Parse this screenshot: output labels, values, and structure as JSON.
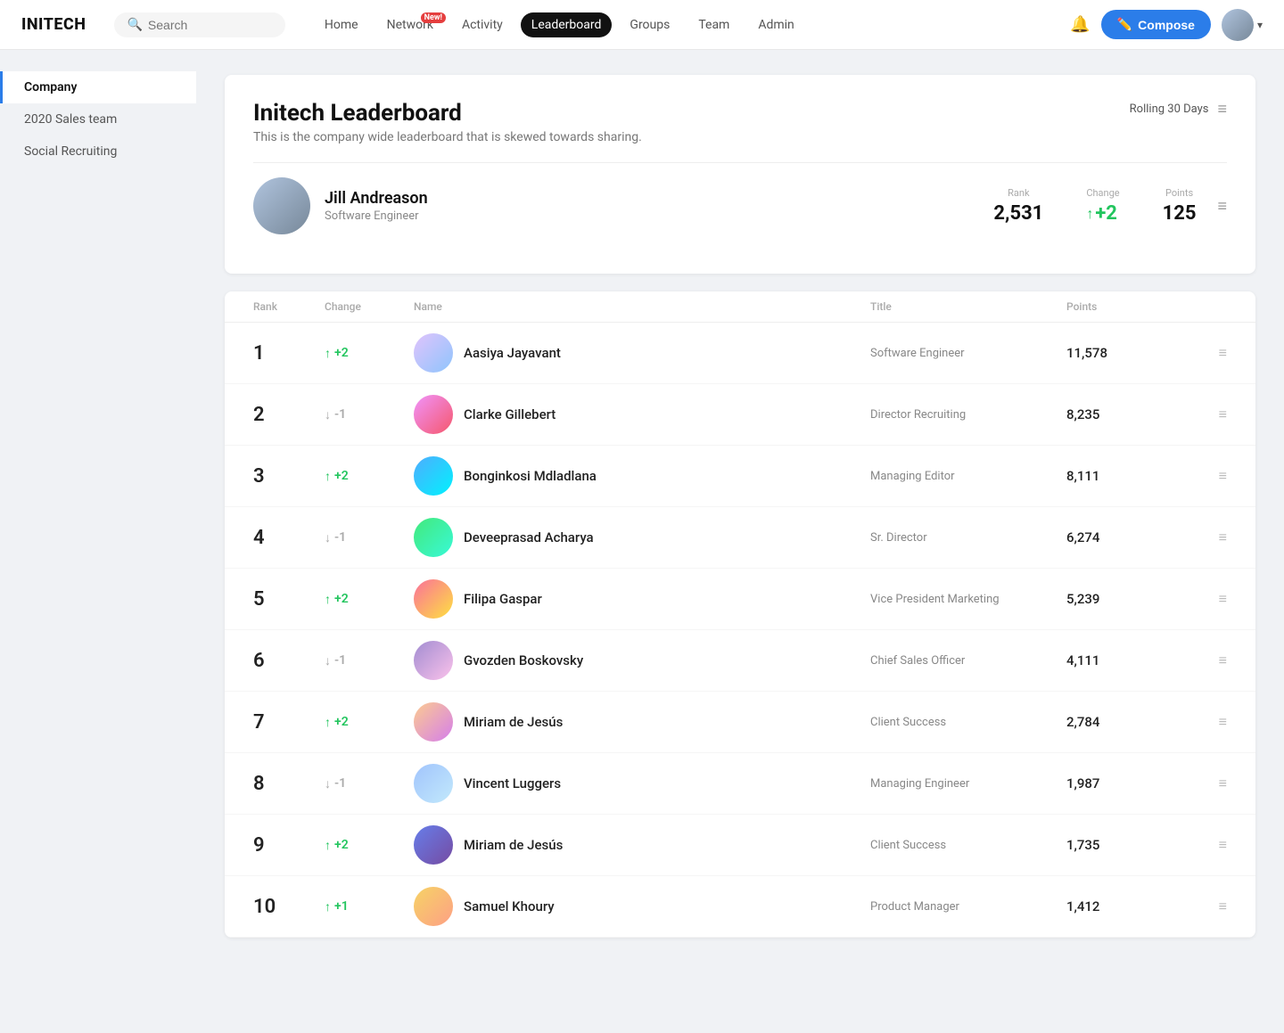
{
  "logo": "INITECH",
  "search": {
    "placeholder": "Search"
  },
  "nav": {
    "links": [
      {
        "id": "home",
        "label": "Home",
        "active": false,
        "badge": null
      },
      {
        "id": "network",
        "label": "Network",
        "active": false,
        "badge": "New!"
      },
      {
        "id": "activity",
        "label": "Activity",
        "active": false,
        "badge": null
      },
      {
        "id": "leaderboard",
        "label": "Leaderboard",
        "active": true,
        "badge": null
      },
      {
        "id": "groups",
        "label": "Groups",
        "active": false,
        "badge": null
      },
      {
        "id": "team",
        "label": "Team",
        "active": false,
        "badge": null
      },
      {
        "id": "admin",
        "label": "Admin",
        "active": false,
        "badge": null
      }
    ],
    "compose_label": "Compose"
  },
  "sidebar": {
    "items": [
      {
        "id": "company",
        "label": "Company",
        "active": true
      },
      {
        "id": "sales-team",
        "label": "2020 Sales team",
        "active": false
      },
      {
        "id": "social-recruiting",
        "label": "Social Recruiting",
        "active": false
      }
    ]
  },
  "leaderboard": {
    "title": "Initech Leaderboard",
    "subtitle": "This is the company wide leaderboard that is skewed towards sharing.",
    "rolling_label": "Rolling 30 Days",
    "current_user": {
      "name": "Jill Andreason",
      "title": "Software Engineer",
      "rank_label": "Rank",
      "rank_value": "2,531",
      "change_label": "Change",
      "change_value": "+2",
      "change_direction": "up",
      "points_label": "Points",
      "points_value": "125"
    },
    "table": {
      "columns": [
        "Rank",
        "Change",
        "Name",
        "Title",
        "Points",
        ""
      ],
      "rows": [
        {
          "rank": 1,
          "change_direction": "up",
          "change_value": "+2",
          "name": "Aasiya Jayavant",
          "title": "Software Engineer",
          "points": "11,578",
          "av": "av1"
        },
        {
          "rank": 2,
          "change_direction": "down",
          "change_value": "-1",
          "name": "Clarke Gillebert",
          "title": "Director Recruiting",
          "points": "8,235",
          "av": "av2"
        },
        {
          "rank": 3,
          "change_direction": "up",
          "change_value": "+2",
          "name": "Bonginkosi Mdladlana",
          "title": "Managing Editor",
          "points": "8,111",
          "av": "av3"
        },
        {
          "rank": 4,
          "change_direction": "down",
          "change_value": "-1",
          "name": "Deveeprasad Acharya",
          "title": "Sr. Director",
          "points": "6,274",
          "av": "av4"
        },
        {
          "rank": 5,
          "change_direction": "up",
          "change_value": "+2",
          "name": "Filipa Gaspar",
          "title": "Vice President Marketing",
          "points": "5,239",
          "av": "av5"
        },
        {
          "rank": 6,
          "change_direction": "down",
          "change_value": "-1",
          "name": "Gvozden Boskovsky",
          "title": "Chief Sales Officer",
          "points": "4,111",
          "av": "av6"
        },
        {
          "rank": 7,
          "change_direction": "up",
          "change_value": "+2",
          "name": "Miriam de Jesús",
          "title": "Client Success",
          "points": "2,784",
          "av": "av7"
        },
        {
          "rank": 8,
          "change_direction": "down",
          "change_value": "-1",
          "name": "Vincent Luggers",
          "title": "Managing Engineer",
          "points": "1,987",
          "av": "av8"
        },
        {
          "rank": 9,
          "change_direction": "up",
          "change_value": "+2",
          "name": "Miriam de Jesús",
          "title": "Client Success",
          "points": "1,735",
          "av": "av9"
        },
        {
          "rank": 10,
          "change_direction": "up",
          "change_value": "+1",
          "name": "Samuel Khoury",
          "title": "Product Manager",
          "points": "1,412",
          "av": "av10"
        }
      ]
    }
  }
}
